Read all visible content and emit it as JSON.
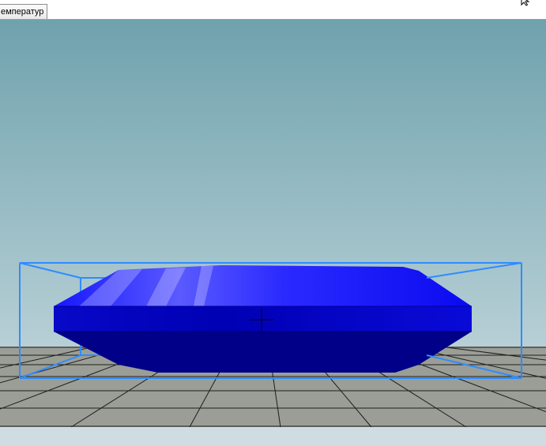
{
  "tabs": [
    {
      "label": "емператур"
    }
  ],
  "icons": {
    "cursor": "mouse-pointer-icon",
    "crosshair": "crosshair-icon"
  },
  "colors": {
    "sky_top": "#6fa2ad",
    "sky_bottom": "#c9dadf",
    "ground": "#9a9e96",
    "grid_line": "#1e1e1e",
    "bounding_box": "#2e8cff",
    "object_top": "#1a1aff",
    "object_side": "#0000c8",
    "object_bottom": "#000088"
  }
}
